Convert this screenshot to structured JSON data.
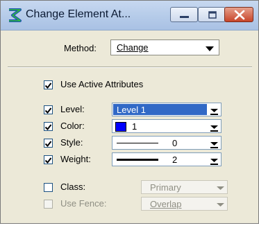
{
  "window": {
    "title": "Change Element At..."
  },
  "method": {
    "label": "Method:",
    "value": "Change"
  },
  "use_active_attributes": {
    "label": "Use Active Attributes",
    "checked": true
  },
  "attributes": [
    {
      "key": "level",
      "label": "Level:",
      "checked": true,
      "value": "Level 1"
    },
    {
      "key": "color",
      "label": "Color:",
      "checked": true,
      "value": "1",
      "swatch": "#0000ff"
    },
    {
      "key": "style",
      "label": "Style:",
      "checked": true,
      "value": "0"
    },
    {
      "key": "weight",
      "label": "Weight:",
      "checked": true,
      "value": "2"
    }
  ],
  "class": {
    "label": "Class:",
    "checked": false,
    "value": "Primary"
  },
  "use_fence": {
    "label": "Use Fence:",
    "checked": false,
    "enabled": false,
    "value": "Overlap"
  },
  "colors": {
    "selection": "#3169c6",
    "title_text": "#0b1a33"
  }
}
